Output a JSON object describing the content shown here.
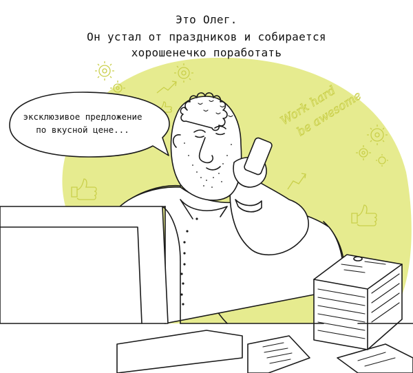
{
  "caption": {
    "line1": "Это Олег.",
    "line2": "Он устал от праздников и собирается",
    "line3": "хорошенечко поработать"
  },
  "speech_bubble": {
    "line1": "эксклюзивое предложение",
    "line2": "по вкусной цене..."
  },
  "background_doodle": {
    "line1": "Work hard",
    "line2": "be awesome"
  },
  "colors": {
    "background_blob": "#e6eb8f",
    "ink": "#1a1a1a",
    "paper": "#ffffff"
  }
}
